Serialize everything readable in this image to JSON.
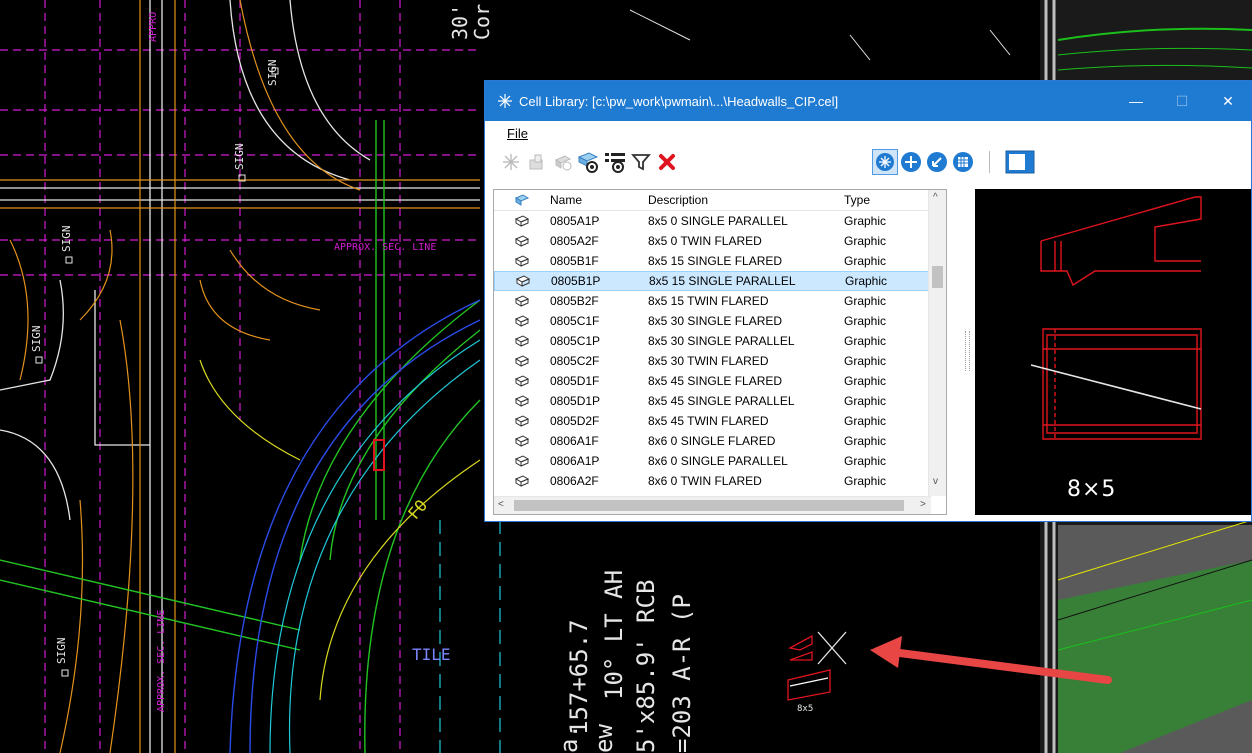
{
  "window": {
    "title": "Cell Library: [c:\\pw_work\\pwmain\\...\\Headwalls_CIP.cel]",
    "minimize": "—",
    "maximize": "☐",
    "close": "✕"
  },
  "menu": {
    "file": "File"
  },
  "list": {
    "columns": {
      "name": "Name",
      "description": "Description",
      "type": "Type"
    },
    "rows": [
      {
        "name": "0805A1P",
        "description": "8x5 0 SINGLE PARALLEL",
        "type": "Graphic"
      },
      {
        "name": "0805A2F",
        "description": "8x5 0 TWIN FLARED",
        "type": "Graphic"
      },
      {
        "name": "0805B1F",
        "description": "8x5 15 SINGLE FLARED",
        "type": "Graphic"
      },
      {
        "name": "0805B1P",
        "description": "8x5 15 SINGLE PARALLEL",
        "type": "Graphic",
        "selected": true
      },
      {
        "name": "0805B2F",
        "description": "8x5 15 TWIN FLARED",
        "type": "Graphic"
      },
      {
        "name": "0805C1F",
        "description": "8x5 30 SINGLE FLARED",
        "type": "Graphic"
      },
      {
        "name": "0805C1P",
        "description": "8x5 30 SINGLE PARALLEL",
        "type": "Graphic"
      },
      {
        "name": "0805C2F",
        "description": "8x5 30 TWIN FLARED",
        "type": "Graphic"
      },
      {
        "name": "0805D1F",
        "description": "8x5 45 SINGLE FLARED",
        "type": "Graphic"
      },
      {
        "name": "0805D1P",
        "description": "8x5 45 SINGLE PARALLEL",
        "type": "Graphic"
      },
      {
        "name": "0805D2F",
        "description": "8x5 45 TWIN FLARED",
        "type": "Graphic"
      },
      {
        "name": "0806A1F",
        "description": "8x6 0 SINGLE FLARED",
        "type": "Graphic"
      },
      {
        "name": "0806A1P",
        "description": "8x6 0 SINGLE PARALLEL",
        "type": "Graphic"
      },
      {
        "name": "0806A2F",
        "description": "8x6 0 TWIN FLARED",
        "type": "Graphic"
      }
    ]
  },
  "preview": {
    "label": "8×5"
  },
  "cad": {
    "labels": {
      "sign1": "SIGN",
      "sign2": "SIGN",
      "sign3": "SIGN",
      "sign4": "SIGN",
      "sign5": "SIGN",
      "approx_top": "APPRO",
      "approx_sec_line": "APPROX. SEC. LINE",
      "approx_sec_line_2": "APPROX. SEC. LINE",
      "fo": "FO",
      "tile": "TILE",
      "dim_30": "30'",
      "dim_cor": "Cor",
      "station_1": "157+65.7",
      "station_2": "10° LT AH",
      "station_3": "5'x85.9' RCB",
      "station_4": "=203 A-R (P",
      "new": "ew",
      "a": "a.",
      "cell_label": "8x5"
    }
  },
  "colors": {
    "titlebar": "#1f7ad2",
    "selection": "#cce8ff",
    "cell_red": "#e0141e",
    "arrow": "#e84545"
  }
}
